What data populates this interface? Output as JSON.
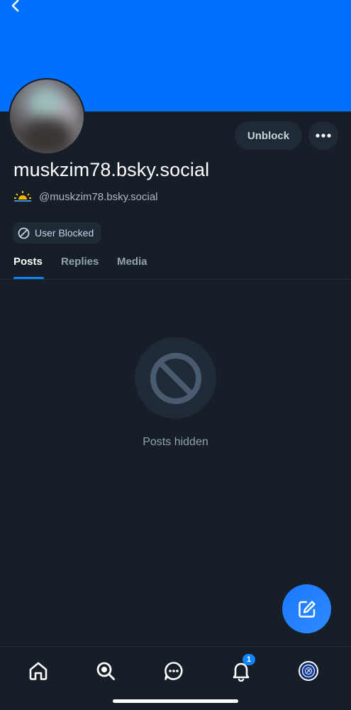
{
  "colors": {
    "banner": "#0070ff",
    "accent": "#1083fe",
    "fab_gradient_start": "#1a78ff",
    "fab_gradient_end": "#2f8bff",
    "badge": "#1083fe",
    "sun": "#f5b800"
  },
  "header": {
    "back_icon": "chevron-left-icon"
  },
  "profile": {
    "display_name": "muskzim78.bsky.social",
    "handle": "@muskzim78.bsky.social",
    "unblock_label": "Unblock",
    "more_icon": "ellipsis-icon",
    "blocked_label": "User Blocked",
    "handle_emoji": "sunrise-icon"
  },
  "tabs": [
    {
      "label": "Posts",
      "active": true
    },
    {
      "label": "Replies",
      "active": false
    },
    {
      "label": "Media",
      "active": false
    }
  ],
  "content": {
    "empty_icon": "blocked-icon",
    "empty_text": "Posts hidden"
  },
  "fab": {
    "icon": "compose-icon"
  },
  "bottom_nav": {
    "items": [
      {
        "icon": "home-icon"
      },
      {
        "icon": "search-icon"
      },
      {
        "icon": "chat-icon"
      },
      {
        "icon": "bell-icon",
        "badge": "1"
      },
      {
        "icon": "profile-avatar-icon"
      }
    ]
  }
}
